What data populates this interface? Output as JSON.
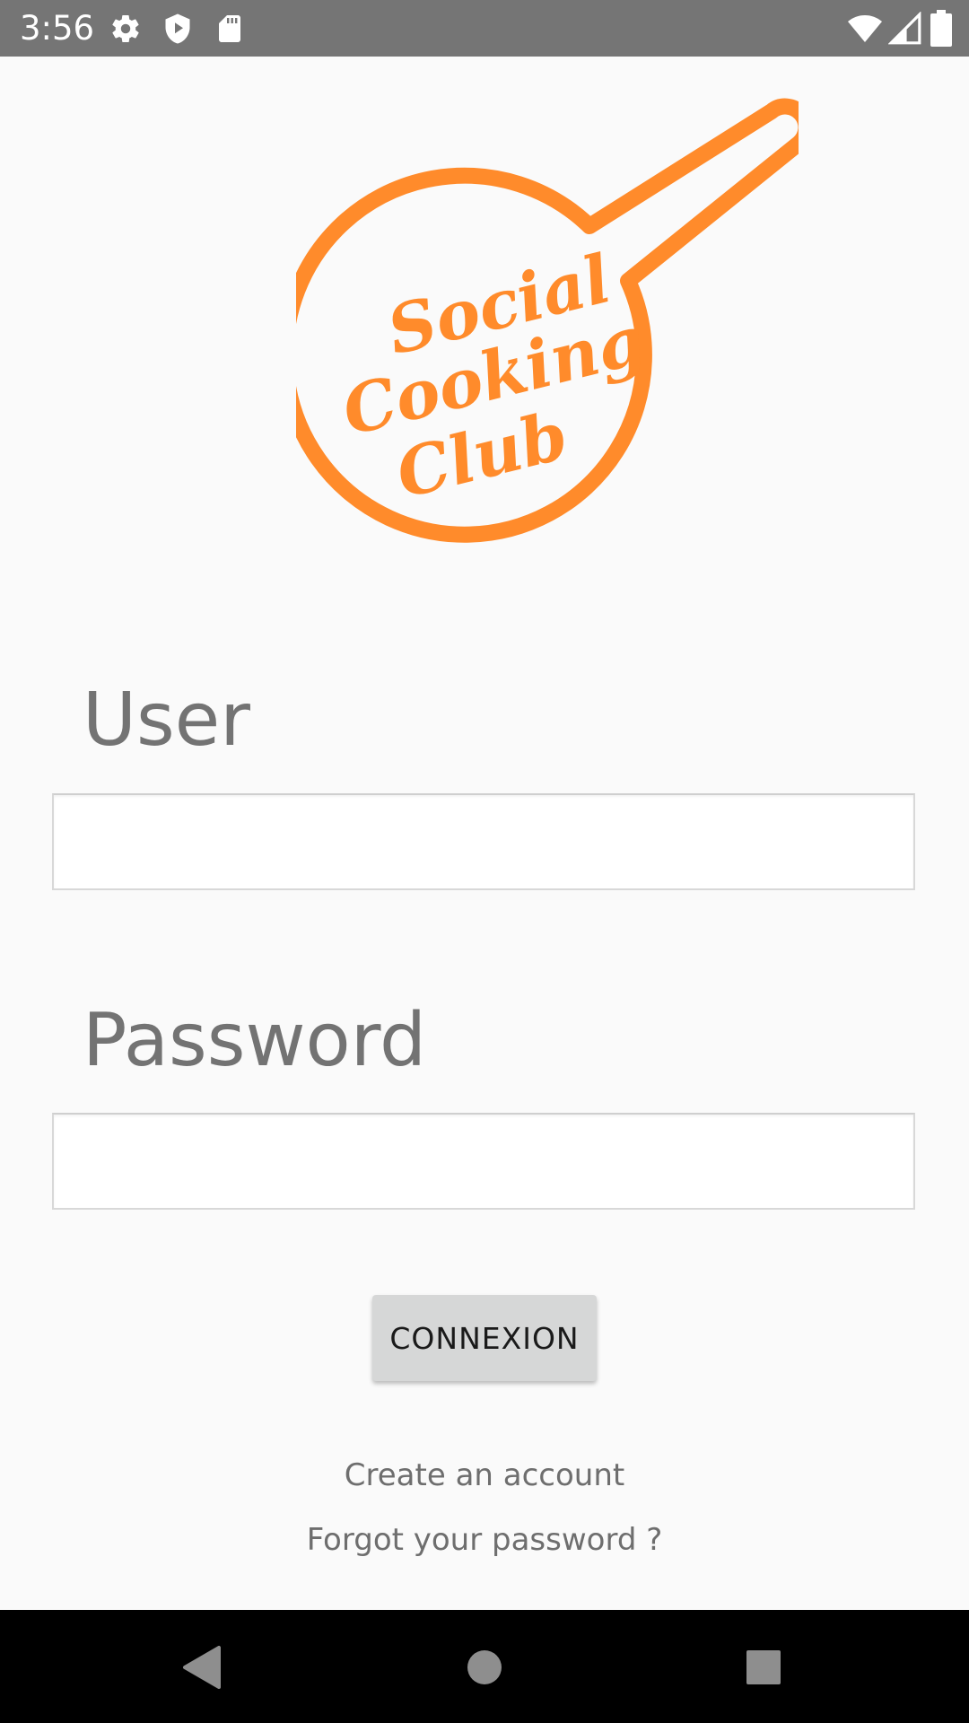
{
  "status_bar": {
    "time": "3:56",
    "icons_left": [
      "gear-icon",
      "shield-play-icon",
      "sd-card-icon"
    ],
    "icons_right": [
      "wifi-icon",
      "cell-signal-icon",
      "battery-icon"
    ]
  },
  "logo": {
    "text_lines": [
      "Social",
      "Cooking",
      "Club"
    ],
    "color": "#ff8b2b"
  },
  "form": {
    "user_label": "User",
    "user_value": "",
    "password_label": "Password",
    "password_value": "",
    "submit_label": "CONNEXION"
  },
  "links": {
    "create_account": "Create an account",
    "forgot_password": "Forgot your password ?"
  },
  "nav_bar": {
    "buttons": [
      "back-icon",
      "home-icon",
      "recents-icon"
    ]
  }
}
